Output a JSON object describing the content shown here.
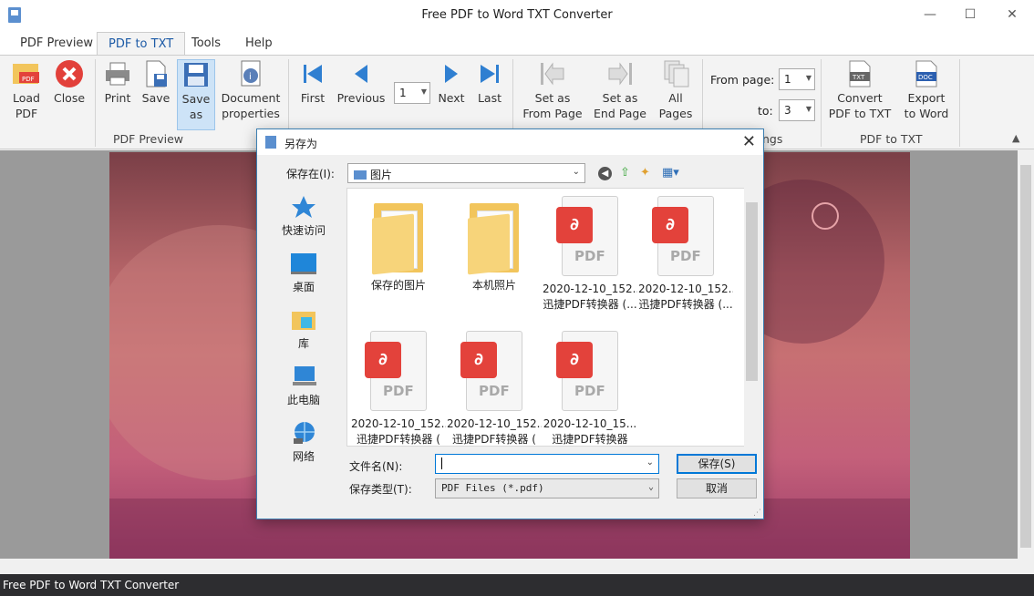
{
  "window": {
    "title": "Free PDF to Word TXT Converter",
    "minimize": "—",
    "maximize": "☐",
    "close": "✕"
  },
  "menu": {
    "tabs": [
      "PDF Preview",
      "PDF to TXT",
      "Tools",
      "Help"
    ],
    "active": "PDF to TXT"
  },
  "ribbon": {
    "buttons": [
      {
        "label": "Load\nPDF",
        "icon": "load-pdf-icon"
      },
      {
        "label": "Close",
        "icon": "close-red-icon"
      },
      {
        "label": "Print",
        "icon": "printer-icon"
      },
      {
        "label": "Save",
        "icon": "save-icon"
      },
      {
        "label": "Save\nas",
        "icon": "save-as-icon",
        "selected": true
      },
      {
        "label": "Document\nproperties",
        "icon": "document-properties-icon"
      },
      {
        "label": "First",
        "icon": "first-page-icon"
      },
      {
        "label": "Previous",
        "icon": "previous-page-icon"
      },
      {
        "label": "Next",
        "icon": "next-page-icon"
      },
      {
        "label": "Last",
        "icon": "last-page-icon"
      },
      {
        "label": "Set as\nFrom Page",
        "icon": "set-from-page-icon"
      },
      {
        "label": "Set as\nEnd Page",
        "icon": "set-end-page-icon"
      },
      {
        "label": "All\nPages",
        "icon": "all-pages-icon"
      },
      {
        "label": "Convert\nPDF to TXT",
        "icon": "txt-file-icon"
      },
      {
        "label": "Export\nto Word",
        "icon": "doc-file-icon"
      }
    ],
    "groups": {
      "pdf_preview": "PDF Preview",
      "settings_partial": "ngs",
      "pdf_to_txt": "PDF to TXT"
    },
    "page_value": "1",
    "from_page_label": "From page:",
    "from_page_value": "1",
    "to_label": "to:",
    "to_value": "3"
  },
  "dialog": {
    "title": "另存为",
    "look_in_label": "保存在(I):",
    "look_in_value": "图片",
    "places": [
      "快速访问",
      "桌面",
      "库",
      "此电脑",
      "网络"
    ],
    "files": [
      {
        "type": "folder",
        "name": "保存的图片",
        "name2": ""
      },
      {
        "type": "folder",
        "name": "本机照片",
        "name2": ""
      },
      {
        "type": "pdf",
        "name": "2020-12-10_152...",
        "name2": "迅捷PDF转换器 (..."
      },
      {
        "type": "pdf",
        "name": "2020-12-10_152...",
        "name2": "迅捷PDF转换器 (..."
      },
      {
        "type": "pdf",
        "name": "2020-12-10_152...",
        "name2": "迅捷PDF转换器 ("
      },
      {
        "type": "pdf",
        "name": "2020-12-10_152...",
        "name2": "迅捷PDF转换器 ("
      },
      {
        "type": "pdf",
        "name": "2020-12-10_15...",
        "name2": "迅捷PDF转换器"
      }
    ],
    "filename_label": "文件名(N):",
    "filename_value": "",
    "filetype_label": "保存类型(T):",
    "filetype_value": "PDF Files (*.pdf)",
    "save_button": "保存(S)",
    "cancel_button": "取消",
    "pdf_badge_text": "PDF"
  },
  "status": {
    "text": "Free PDF to Word TXT Converter"
  }
}
